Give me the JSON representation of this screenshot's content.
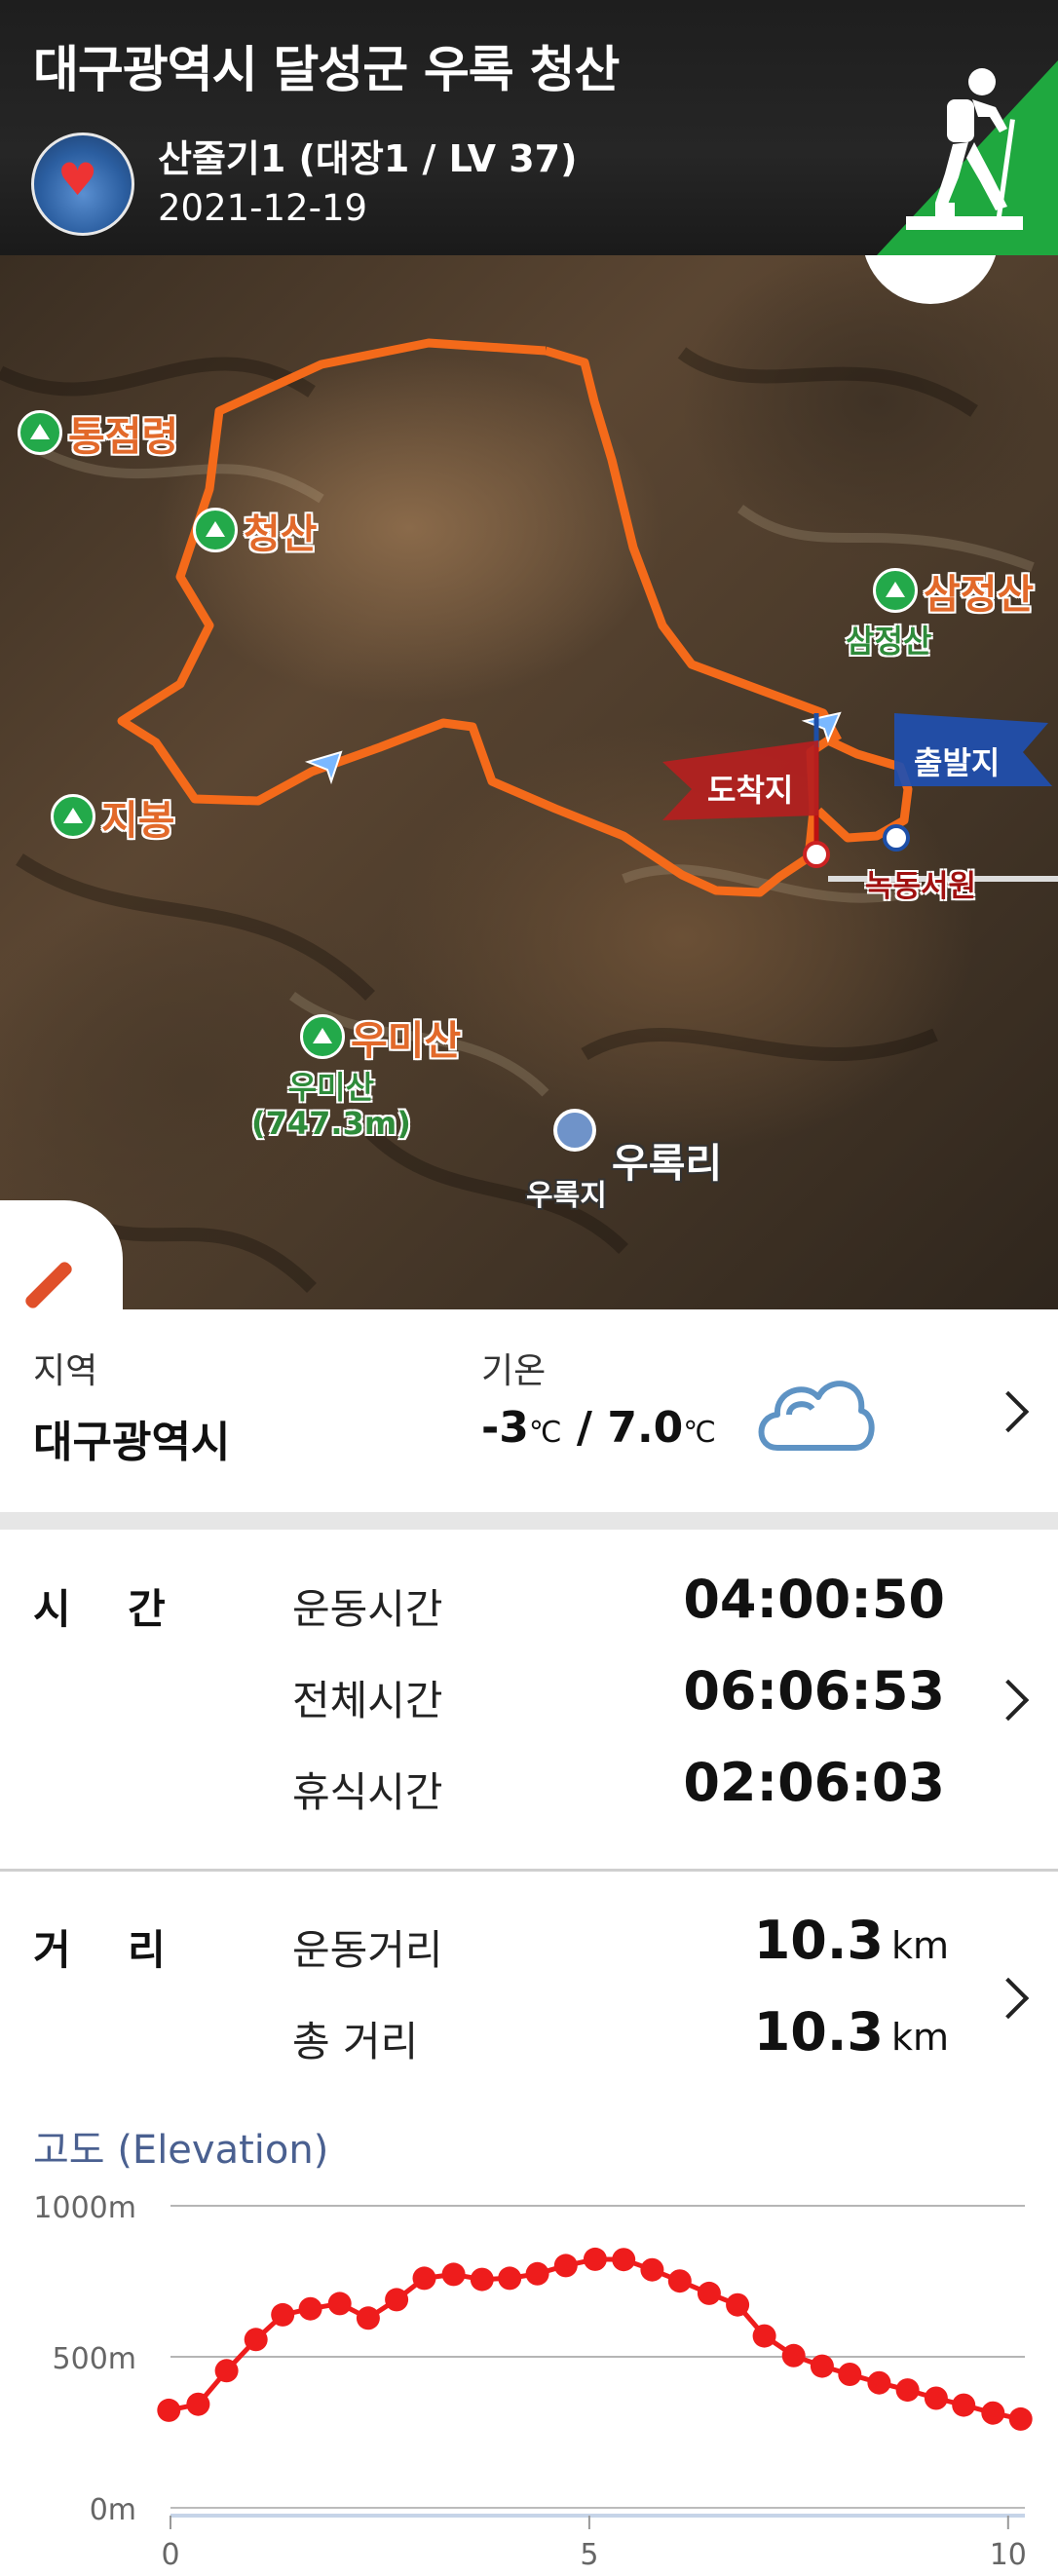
{
  "header": {
    "title": "대구광역시 달성군 우록 청산",
    "user": "산줄기1 (대장1 / LV 37)",
    "date": "2021-12-19"
  },
  "map": {
    "peaks": [
      "통점령",
      "청산",
      "삼정산",
      "지봉",
      "우미산"
    ],
    "sub_labels": {
      "samjeong": "삼정산",
      "umi": "우미산",
      "umi_height": "(747.3m)"
    },
    "flags": {
      "finish": "도착지",
      "start": "출발지"
    },
    "places": {
      "nokdong": "녹동서원",
      "urokri": "우록리",
      "urokji": "우록지"
    }
  },
  "info": {
    "region_label": "지역",
    "region_value": "대구광역시",
    "temp_label": "기온",
    "temp_low": "-3",
    "temp_high": "7.0",
    "temp_unit": "℃",
    "temp_sep": "/"
  },
  "time": {
    "title": "시    간",
    "rows": [
      {
        "label": "운동시간",
        "value": "04:00:50"
      },
      {
        "label": "전체시간",
        "value": "06:06:53"
      },
      {
        "label": "휴식시간",
        "value": "02:06:03"
      }
    ]
  },
  "distance": {
    "title": "거    리",
    "unit": "km",
    "rows": [
      {
        "label": "운동거리",
        "value": "10.3"
      },
      {
        "label": "총 거리",
        "value": "10.3"
      }
    ]
  },
  "chart_data": {
    "type": "line",
    "title": "고도 (Elevation)",
    "xlabel": "",
    "ylabel": "",
    "xlim": [
      0,
      10.3
    ],
    "ylim": [
      0,
      1000
    ],
    "x_ticks": [
      "0",
      "5",
      "10"
    ],
    "y_ticks": [
      "0m",
      "500m",
      "1000m"
    ],
    "grid": true,
    "color": "#ee1c1c",
    "series": [
      {
        "x": [
          -0.02,
          0.33,
          0.67,
          1.02,
          1.34,
          1.67,
          2.02,
          2.36,
          2.7,
          3.03,
          3.38,
          3.72,
          4.05,
          4.38,
          4.72,
          5.07,
          5.41,
          5.75,
          6.08,
          6.43,
          6.77,
          7.09,
          7.44,
          7.78,
          8.11,
          8.46,
          8.8,
          9.14,
          9.47,
          9.82,
          10.15
        ],
        "y": [
          323,
          343,
          454,
          557,
          639,
          659,
          676,
          628,
          689,
          760,
          773,
          756,
          760,
          775,
          802,
          823,
          822,
          788,
          751,
          710,
          672,
          569,
          504,
          469,
          442,
          414,
          390,
          363,
          340,
          314,
          294
        ]
      }
    ]
  }
}
